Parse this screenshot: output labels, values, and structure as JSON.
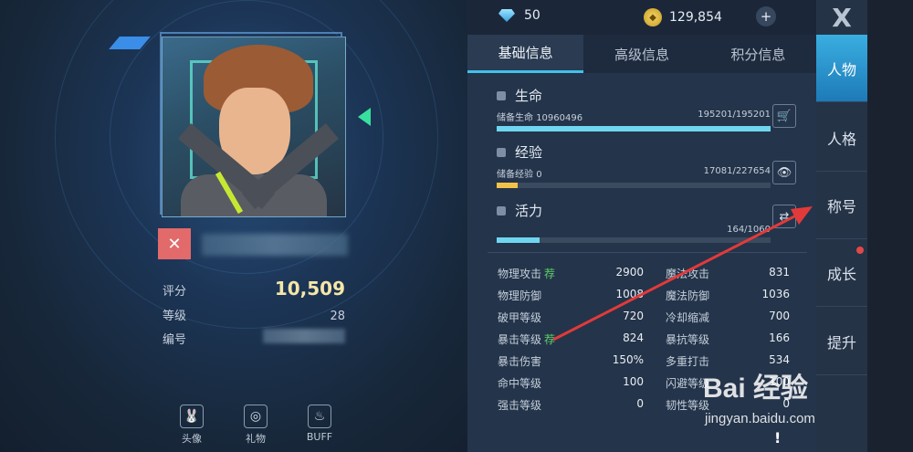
{
  "currency": {
    "gems": "50",
    "gold": "129,854",
    "add_label": "+"
  },
  "tabs": [
    {
      "label": "基础信息",
      "active": true
    },
    {
      "label": "高级信息",
      "active": false
    },
    {
      "label": "积分信息",
      "active": false
    }
  ],
  "bars": {
    "life": {
      "title": "生命",
      "sub_label": "储备生命",
      "sub_value": "10960496",
      "ratio": "195201/195201",
      "fraction": 1.0,
      "color": "#6fd6f0"
    },
    "exp": {
      "title": "经验",
      "sub_label": "储备经验",
      "sub_value": "0",
      "ratio": "17081/227654",
      "fraction": 0.075,
      "color": "#f2c34a"
    },
    "energy": {
      "title": "活力",
      "sub_label": "",
      "sub_value": "",
      "ratio": "164/1060",
      "fraction": 0.155,
      "color": "#6fd6f0"
    }
  },
  "attrs": {
    "r0": {
      "l1": "物理攻击",
      "l1_rec": "荐",
      "v1": "2900",
      "l2": "魔法攻击",
      "v2": "831"
    },
    "r1": {
      "l1": "物理防御",
      "l1_rec": "",
      "v1": "1008",
      "l2": "魔法防御",
      "v2": "1036"
    },
    "r2": {
      "l1": "破甲等级",
      "l1_rec": "",
      "v1": "720",
      "l2": "冷却缩减",
      "v2": "700"
    },
    "r3": {
      "l1": "暴击等级",
      "l1_rec": "荐",
      "v1": "824",
      "l2": "暴抗等级",
      "v2": "166"
    },
    "r4": {
      "l1": "暴击伤害",
      "l1_rec": "",
      "v1": "150%",
      "l2": "多重打击",
      "v2": "534"
    },
    "r5": {
      "l1": "命中等级",
      "l1_rec": "",
      "v1": "100",
      "l2": "闪避等级",
      "v2": "100"
    },
    "r6": {
      "l1": "强击等级",
      "l1_rec": "",
      "v1": "0",
      "l2": "韧性等级",
      "v2": "0"
    }
  },
  "profile": {
    "score_label": "评分",
    "score": "10,509",
    "level_label": "等级",
    "level": "28",
    "id_label": "编号"
  },
  "bottom_buttons": [
    {
      "label": "头像",
      "icon": "rabbit-icon"
    },
    {
      "label": "礼物",
      "icon": "gift-icon"
    },
    {
      "label": "BUFF",
      "icon": "flame-icon"
    }
  ],
  "sidenav": {
    "close": "X",
    "items": [
      {
        "label": "人物",
        "active": true
      },
      {
        "label": "人格",
        "active": false
      },
      {
        "label": "称号",
        "active": false
      },
      {
        "label": "成长",
        "active": false,
        "dot": true
      },
      {
        "label": "提升",
        "active": false
      }
    ]
  },
  "watermark": {
    "main": "Bai 经验",
    "sub": "jingyan.baidu.com"
  },
  "warn": "!"
}
